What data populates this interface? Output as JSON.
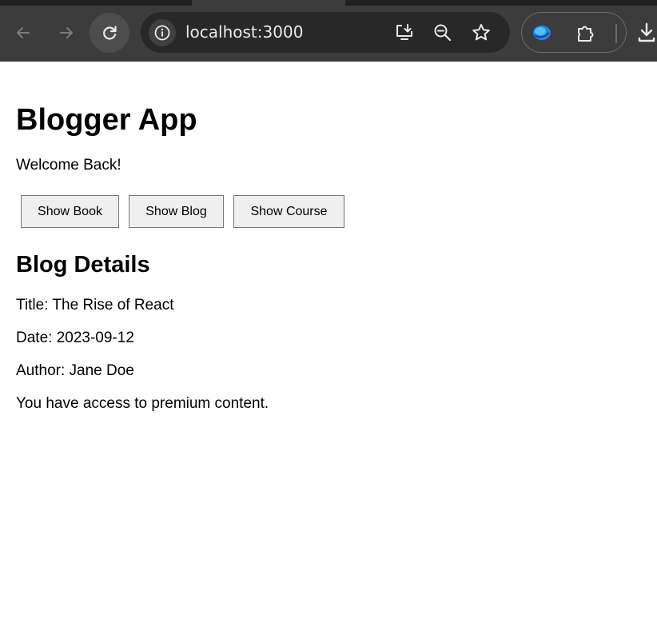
{
  "browser": {
    "url": "localhost:3000",
    "icons": {
      "back": "arrow-left-icon",
      "forward": "arrow-right-icon",
      "reload": "reload-icon",
      "site_info": "info-icon",
      "install": "install-app-icon",
      "zoom": "zoom-out-icon",
      "bookmark": "star-icon",
      "extension": "extension-blue-icon",
      "extensions_menu": "puzzle-icon",
      "download": "download-icon"
    }
  },
  "app": {
    "title": "Blogger App",
    "welcome": "Welcome Back!",
    "buttons": {
      "book": "Show Book",
      "blog": "Show Blog",
      "course": "Show Course"
    }
  },
  "blog": {
    "heading": "Blog Details",
    "title_line": "Title: The Rise of React",
    "date_line": "Date: 2023-09-12",
    "author_line": "Author: Jane Doe",
    "access_line": "You have access to premium content."
  },
  "colors": {
    "chrome_bg": "#3c3c3c",
    "omnibox_bg": "#282828",
    "button_bg": "#efefef",
    "button_border": "#767676"
  }
}
